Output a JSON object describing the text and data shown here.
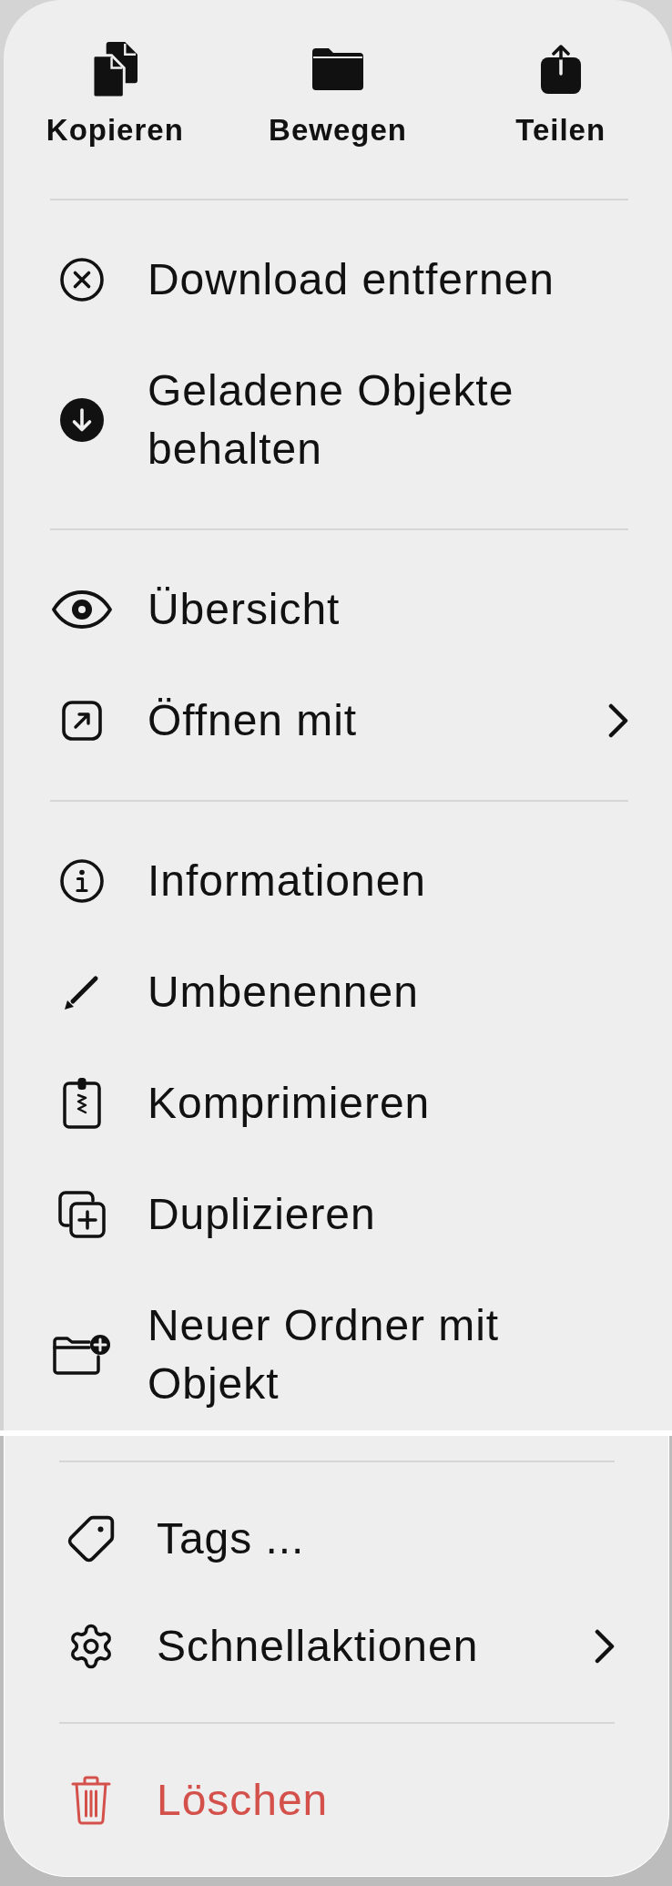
{
  "quick_actions": [
    {
      "label": "Kopieren"
    },
    {
      "label": "Bewegen"
    },
    {
      "label": "Teilen"
    }
  ],
  "panels": [
    {
      "sections": [
        {
          "items": [
            {
              "label": "Download entfernen",
              "kind": "action"
            },
            {
              "label": "Geladene Objekte behalten",
              "kind": "action"
            }
          ]
        },
        {
          "items": [
            {
              "label": "Übersicht",
              "kind": "action"
            },
            {
              "label": "Öffnen mit",
              "kind": "submenu"
            }
          ]
        },
        {
          "items": [
            {
              "label": "Informationen",
              "kind": "action"
            },
            {
              "label": "Umbenennen",
              "kind": "action"
            },
            {
              "label": "Komprimieren",
              "kind": "action"
            },
            {
              "label": "Duplizieren",
              "kind": "action"
            },
            {
              "label": "Neuer Ordner mit Objekt",
              "kind": "action"
            }
          ]
        }
      ]
    },
    {
      "sections": [
        {
          "items": [
            {
              "label": "Tags ...",
              "kind": "action"
            },
            {
              "label": "Schnellaktionen",
              "kind": "submenu"
            }
          ]
        },
        {
          "items": [
            {
              "label": "Löschen",
              "kind": "destructive"
            }
          ]
        }
      ]
    }
  ]
}
